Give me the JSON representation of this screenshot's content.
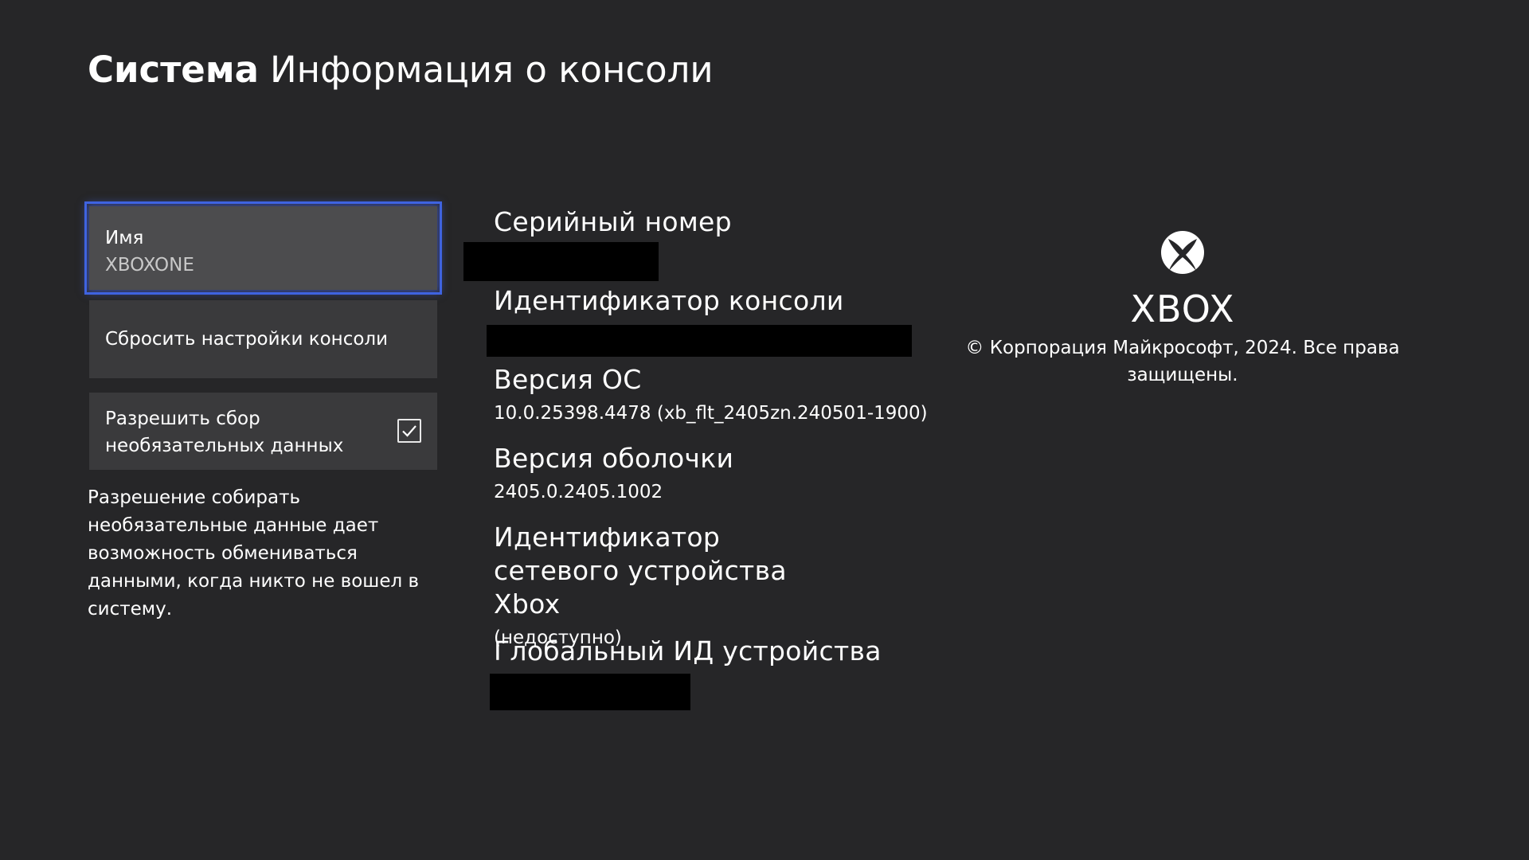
{
  "header": {
    "section": "Система",
    "title": "Информация о консоли"
  },
  "left_menu": {
    "name_tile": {
      "label": "Имя",
      "value": "XBOXONE"
    },
    "reset_label": "Сбросить настройки консоли",
    "optional_data": {
      "label": "Разрешить сбор необязательных данных",
      "checked": true
    },
    "help_text": "Разрешение собирать необязательные данные дает возможность обмениваться данными, когда никто не вошел в систему."
  },
  "info": {
    "serial": {
      "label": "Серийный номер"
    },
    "console_id": {
      "label": "Идентификатор консоли"
    },
    "os_version": {
      "label": "Версия ОС",
      "value": "10.0.25398.4478 (xb_flt_2405zn.240501-1900)"
    },
    "shell_version": {
      "label": "Версия оболочки",
      "value": "2405.0.2405.1002"
    },
    "network_device_id": {
      "label": "Идентификатор сетевого устройства Xbox",
      "value": "(недоступно)"
    },
    "global_device_id": {
      "label": "Глобальный ИД устройства"
    }
  },
  "brand": {
    "logo_icon": "xbox-logo-icon",
    "name": "XBOX",
    "copyright": "© Корпорация Майкрософт, 2024. Все права защищены."
  },
  "colors": {
    "background": "#262628",
    "tile": "#3a3a3c",
    "tile_focused": "#4c4c4e",
    "focus_outline": "#3f63e0",
    "redaction": "#000000"
  }
}
